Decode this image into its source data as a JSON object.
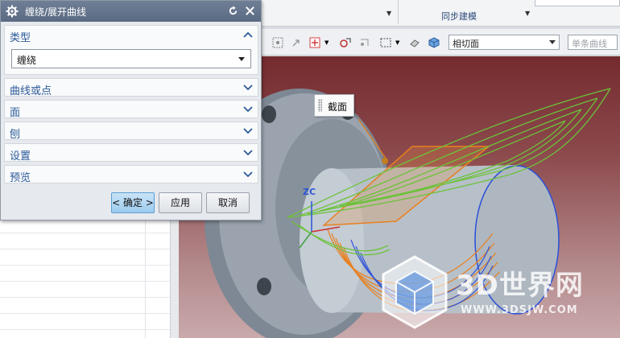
{
  "ribbon": {
    "sync_label": "同步建模"
  },
  "toolbar": {
    "face_filter": "相切面",
    "curve_filter": "单条曲线"
  },
  "dialog": {
    "title": "缠绕/展开曲线",
    "sections": {
      "type": {
        "label": "类型",
        "value": "缠绕"
      },
      "curve_or_point": {
        "label": "曲线或点"
      },
      "face": {
        "label": "面"
      },
      "plane": {
        "label": "刨"
      },
      "settings": {
        "label": "设置"
      },
      "preview": {
        "label": "预览"
      }
    },
    "buttons": {
      "ok": "< 确定 >",
      "apply": "应用",
      "cancel": "取消"
    }
  },
  "viewport": {
    "section_label": "截面",
    "axis_label": "ZC"
  },
  "watermark": {
    "title": "3D世界网",
    "url": "WWW.3DSJW.COM"
  },
  "colors": {
    "dialog_title_bg": "#5f6f87",
    "section_label": "#2b5a99",
    "viewport_top": "#742b2e",
    "viewport_bottom": "#c9a9ab",
    "curve_green": "#6cc23a",
    "curve_orange": "#e8801f",
    "curve_blue": "#2b4fd8"
  }
}
